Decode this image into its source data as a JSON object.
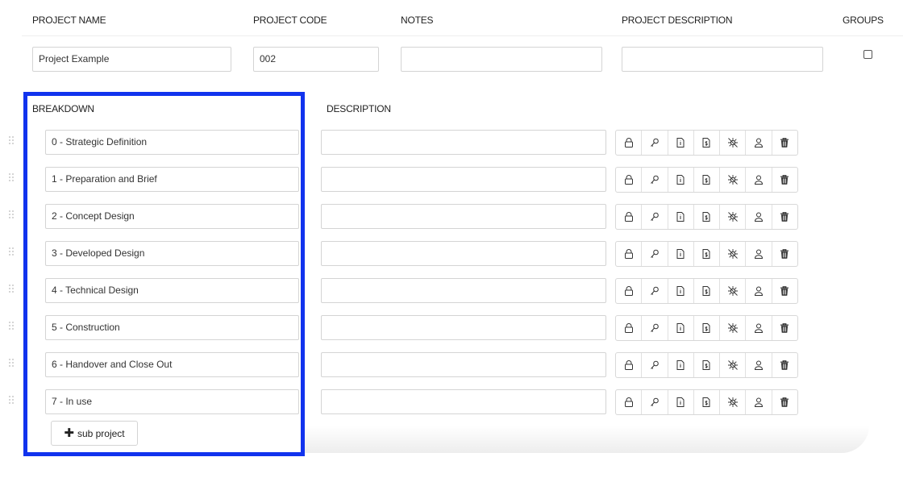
{
  "headers": {
    "project_name": "PROJECT NAME",
    "project_code": "PROJECT CODE",
    "notes": "NOTES",
    "project_description": "PROJECT DESCRIPTION",
    "groups": "GROUPS"
  },
  "project": {
    "name": "Project Example",
    "code": "002",
    "notes": "",
    "description": "",
    "groups_checked": false
  },
  "breakdown": {
    "header": "BREAKDOWN",
    "description_header": "DESCRIPTION",
    "rows": [
      {
        "name": "0 - Strategic Definition",
        "description": ""
      },
      {
        "name": "1 - Preparation and Brief",
        "description": ""
      },
      {
        "name": "2 - Concept Design",
        "description": ""
      },
      {
        "name": "3 - Developed Design",
        "description": ""
      },
      {
        "name": "4 - Technical Design",
        "description": ""
      },
      {
        "name": "5 - Construction",
        "description": ""
      },
      {
        "name": "6 - Handover and Close Out",
        "description": ""
      },
      {
        "name": "7 - In use",
        "description": ""
      }
    ],
    "row_actions": [
      "lock-icon",
      "key-icon",
      "document-info-icon",
      "document-dollar-icon",
      "virus-icon",
      "user-icon",
      "trash-icon"
    ],
    "add_button_label": "sub project"
  },
  "colors": {
    "highlight": "#1133ee",
    "border": "#d4d4d4"
  }
}
